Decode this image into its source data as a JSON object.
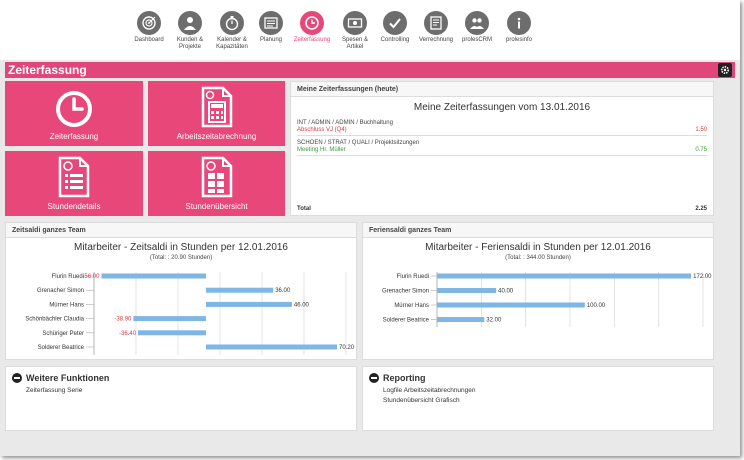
{
  "nav": [
    {
      "id": "dashboard",
      "label": "Dashboard",
      "icon": "target-icon"
    },
    {
      "id": "kunden",
      "label": "Kunden &\nProjekte",
      "icon": "person-icon"
    },
    {
      "id": "kalender",
      "label": "Kalender &\nKapazitäten",
      "icon": "stopwatch-icon"
    },
    {
      "id": "planung",
      "label": "Planung",
      "icon": "planning-board-icon"
    },
    {
      "id": "zeiterfassung",
      "label": "Zeiterfassung",
      "icon": "clock-icon",
      "active": true
    },
    {
      "id": "spesen",
      "label": "Spesen &\nArtikel",
      "icon": "money-icon"
    },
    {
      "id": "controlling",
      "label": "Controlling",
      "icon": "checkmark-icon"
    },
    {
      "id": "verrechnung",
      "label": "Verrechnung",
      "icon": "invoice-icon"
    },
    {
      "id": "prolescrm",
      "label": "prolesCRM",
      "icon": "group-icon"
    },
    {
      "id": "prolesinfo",
      "label": "prolesinfo",
      "icon": "info-icon"
    }
  ],
  "page": {
    "title": "Zeiterfassung"
  },
  "tiles": {
    "zeiterfassung": "Zeiterfassung",
    "arbeitszeit": "Arbeitszeitabrechnung",
    "stundendetails": "Stundendetails",
    "stundenuebersicht": "Stundenübersicht"
  },
  "today": {
    "panel_title": "Meine Zeiterfassungen (heute)",
    "heading": "Meine Zeiterfassungen vom 13.01.2016",
    "entries": [
      {
        "path": "INT / ADMIN / ADMIN / Buchhaltung",
        "detail": "Abschluss VJ (Q4)",
        "hours": "1.50",
        "color": "#d9363e"
      },
      {
        "path": "SCHOEN / STRAT / QUALI / Projektsitzungen",
        "detail": "Meeting Hr. Müller",
        "hours": "0.75",
        "color": "#3a9a3a"
      }
    ],
    "total_label": "Total",
    "total_value": "2.25"
  },
  "zeitsaldi": {
    "panel_title": "Zeitsaldi ganzes Team",
    "chart_title": "Mitarbeiter - Zeitsaldi in Stunden per 12.01.2016",
    "chart_subtitle": "(Total: : 20.90 Stunden)"
  },
  "feriensaldi": {
    "panel_title": "Feriensaldi ganzes Team",
    "chart_title": "Mitarbeiter - Feriensaldi in Stunden per 12.01.2016",
    "chart_subtitle": "(Total: : 344.00 Stunden)"
  },
  "chart_data": [
    {
      "type": "bar",
      "orientation": "horizontal",
      "title": "Mitarbeiter - Zeitsaldi in Stunden per 12.01.2016",
      "subtitle": "(Total: : 20.90 Stunden)",
      "categories": [
        "Flurin Ruedi",
        "Grenacher Simon",
        "Mürner Hans",
        "Schönbächler Claudia",
        "Schüriger Peter",
        "Solderer Beatrice"
      ],
      "values": [
        -56.0,
        36.0,
        46.0,
        -38.9,
        -36.4,
        70.2
      ],
      "labels": [
        "-56.00",
        "36.00",
        "46.00",
        "-38.90",
        "-36.40",
        "70.20"
      ],
      "xlim": [
        -60,
        75
      ],
      "grid": true,
      "bar_color": "#7eb6e6",
      "negative_label_color": "#d9363e"
    },
    {
      "type": "bar",
      "orientation": "horizontal",
      "title": "Mitarbeiter - Feriensaldi in Stunden per 12.01.2016",
      "subtitle": "(Total: : 344.00 Stunden)",
      "categories": [
        "Flurin Ruedi",
        "Grenacher Simon",
        "Mürner Hans",
        "Solderer Beatrice"
      ],
      "values": [
        172.0,
        40.0,
        100.0,
        32.0
      ],
      "labels": [
        "172.00",
        "40.00",
        "100.00",
        "32.00"
      ],
      "xlim": [
        0,
        180
      ],
      "grid": true,
      "bar_color": "#7eb6e6"
    }
  ],
  "weitere": {
    "title": "Weitere Funktionen",
    "links": [
      "Zeiterfassung Serie"
    ]
  },
  "reporting": {
    "title": "Reporting",
    "links": [
      "Logfile Arbeitszeitabrechnungen",
      "Stundenübersicht Grafisch"
    ]
  }
}
